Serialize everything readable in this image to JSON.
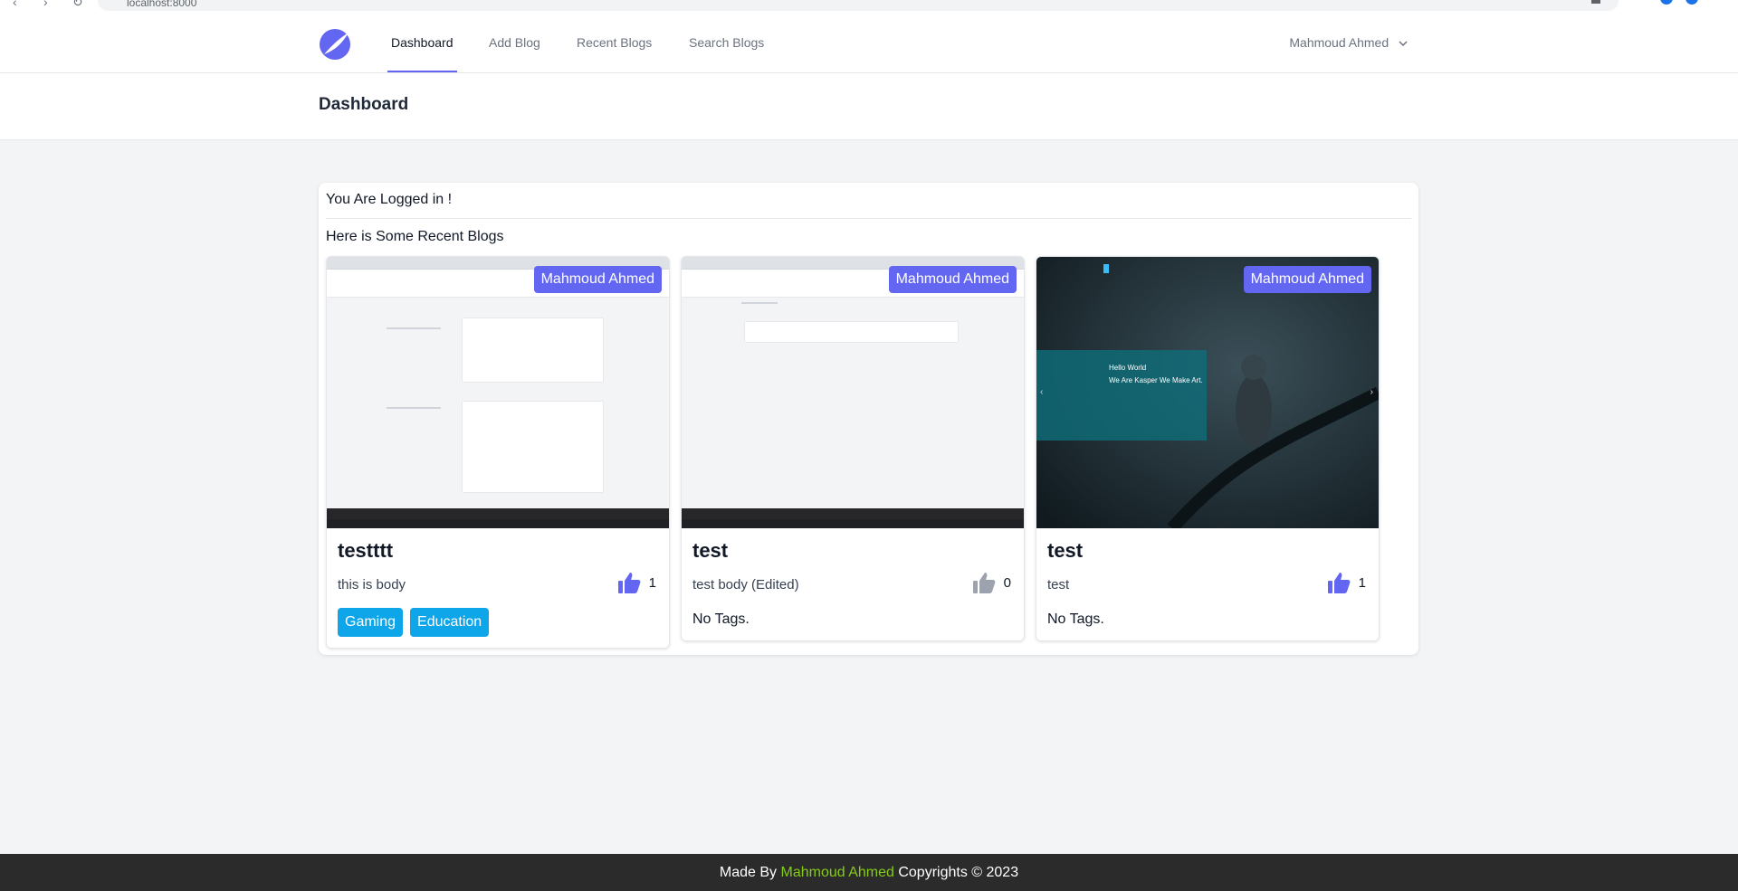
{
  "browser": {
    "url": "localhost:8000"
  },
  "nav": {
    "links": [
      "Dashboard",
      "Add Blog",
      "Recent Blogs",
      "Search Blogs"
    ],
    "active": "Dashboard",
    "user": "Mahmoud Ahmed"
  },
  "header": {
    "title": "Dashboard"
  },
  "main": {
    "logged_message": "You Are Logged in !",
    "recent_message": "Here is Some Recent Blogs",
    "cards": [
      {
        "author": "Mahmoud Ahmed",
        "title": "testttt",
        "body": "this is body",
        "likes": "1",
        "liked": true,
        "tags": [
          "Gaming",
          "Education"
        ],
        "no_tags": ""
      },
      {
        "author": "Mahmoud Ahmed",
        "title": "test",
        "body": "test body (Edited)",
        "likes": "0",
        "liked": false,
        "tags": [],
        "no_tags": "No Tags."
      },
      {
        "author": "Mahmoud Ahmed",
        "title": "test",
        "body": "test",
        "likes": "1",
        "liked": true,
        "tags": [],
        "no_tags": "No Tags."
      }
    ],
    "mock_hero": {
      "line1": "Hello World",
      "line2": "We Are Kasper We Make Art."
    }
  },
  "footer": {
    "prefix": "Made By",
    "name": "Mahmoud Ahmed",
    "suffix": "Copyrights © 2023"
  },
  "colors": {
    "accent": "#6366f1",
    "tag": "#0ea5e9",
    "footer_name": "#84cc16",
    "like_active": "#6366f1",
    "like_inactive": "#9ca3af"
  }
}
